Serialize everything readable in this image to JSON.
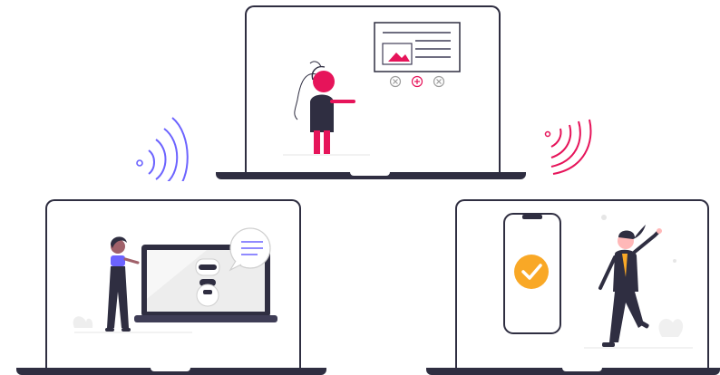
{
  "illustration": {
    "top_laptop": {
      "figure": "person-presenting",
      "screen_content": "chart-card-icon",
      "card_buttons": [
        "close-circle-icon",
        "plus-circle-icon",
        "close-circle-icon"
      ]
    },
    "left_laptop": {
      "figure": "person-with-robot-laptop",
      "screen_content": "robot-icon",
      "bubble": "chat-bubble-icon"
    },
    "right_laptop": {
      "figure": "person-celebrating",
      "screen_content": "phone-checkmark-icon"
    },
    "signals": [
      "wifi-signal-left-icon",
      "wifi-signal-right-icon"
    ]
  },
  "colors": {
    "outline": "#2f2e41",
    "accent_red": "#e6145a",
    "accent_purple": "#6c63ff",
    "accent_yellow": "#f9a826",
    "light_gray": "#e6e6e6",
    "mid_gray": "#cfcfcf"
  }
}
